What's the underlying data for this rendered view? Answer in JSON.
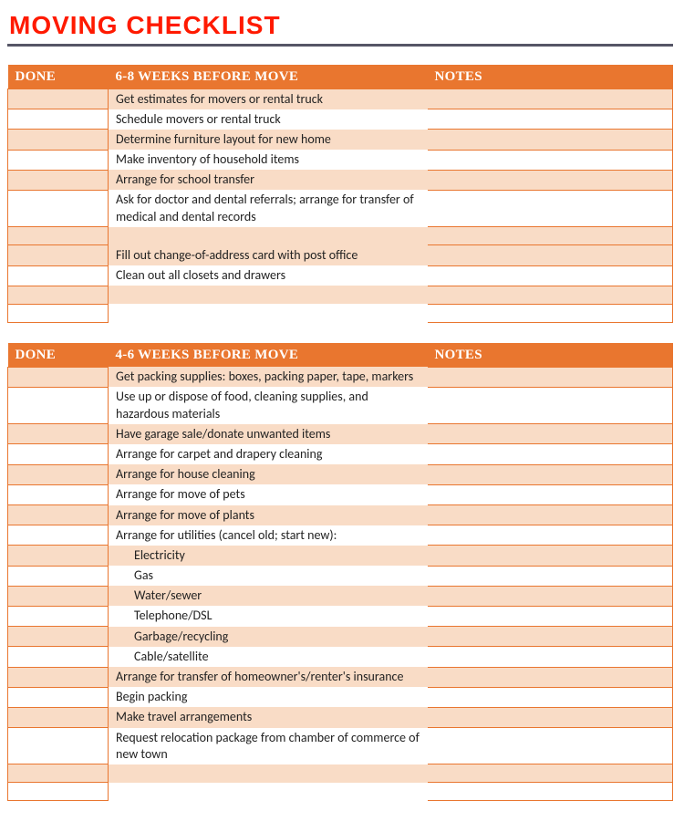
{
  "title": "MOVING CHECKLIST",
  "columns": {
    "done": "DONE",
    "notes": "NOTES"
  },
  "sections": [
    {
      "heading": "6-8 WEEKS BEFORE MOVE",
      "rows": [
        {
          "task": "Get estimates for movers or rental truck"
        },
        {
          "task": "Schedule movers or rental truck"
        },
        {
          "task": "Determine furniture layout for new home"
        },
        {
          "task": "Make inventory of household items"
        },
        {
          "task": "Arrange for school transfer"
        },
        {
          "task": "Ask for doctor and dental referrals; arrange for transfer of medical and dental records"
        },
        {
          "task": "Fill out change-of-address card with post office",
          "lead_blank": true
        },
        {
          "task": "Clean out all closets and drawers"
        },
        {
          "task": ""
        },
        {
          "task": ""
        }
      ]
    },
    {
      "heading": "4-6 WEEKS BEFORE MOVE",
      "rows": [
        {
          "task": "Get packing supplies: boxes, packing paper, tape, markers"
        },
        {
          "task": "Use up or dispose of food, cleaning supplies, and hazardous materials"
        },
        {
          "task": "Have garage sale/donate unwanted items"
        },
        {
          "task": "Arrange for carpet and drapery cleaning"
        },
        {
          "task": "Arrange for house cleaning"
        },
        {
          "task": "Arrange for move of pets"
        },
        {
          "task": "Arrange for move of plants"
        },
        {
          "task": "Arrange for utilities (cancel old; start new):"
        },
        {
          "task": "Electricity",
          "indent": true
        },
        {
          "task": "Gas",
          "indent": true
        },
        {
          "task": "Water/sewer",
          "indent": true
        },
        {
          "task": "Telephone/DSL",
          "indent": true
        },
        {
          "task": "Garbage/recycling",
          "indent": true
        },
        {
          "task": "Cable/satellite",
          "indent": true
        },
        {
          "task": "Arrange for transfer of homeowner's/renter's insurance"
        },
        {
          "task": "Begin packing"
        },
        {
          "task": "Make travel arrangements"
        },
        {
          "task": "Request relocation package from chamber of commerce of new town"
        },
        {
          "task": ""
        },
        {
          "task": ""
        }
      ]
    }
  ]
}
